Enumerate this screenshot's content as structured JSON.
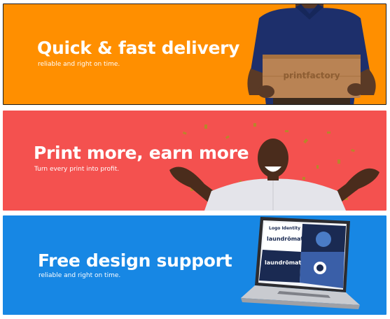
{
  "banners": [
    {
      "headline": "Quick & fast delivery",
      "subtext": "reliable and right on time.",
      "background": "#FF8F00",
      "box_label": "printfactory"
    },
    {
      "headline": "Print more, earn more",
      "subtext": "Turn every print into profit.",
      "background": "#F4514F"
    },
    {
      "headline": "Free design support",
      "subtext": "reliable and right on time.",
      "background": "#1787E4",
      "screen": {
        "title": "Logo Identity",
        "brand_1": "laundrömat",
        "brand_2": "laundrömat"
      }
    }
  ]
}
